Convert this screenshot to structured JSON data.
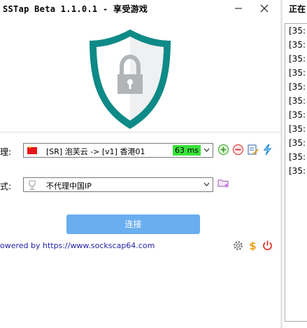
{
  "window": {
    "title": "SSTap Beta 1.1.0.1 - 享受游戏"
  },
  "proxy": {
    "label": "理:",
    "server": "[SR] 泡芙云 -> [v1] 香港01",
    "latency": "63 ms",
    "flag_icon": "china-flag-icon"
  },
  "mode": {
    "label": "式:",
    "value": "不代理中国IP"
  },
  "connect_label": "连接",
  "powered_text": "owered by https://www.sockscap64.com",
  "log": {
    "title": "正在",
    "lines": [
      "[35:",
      "[35:",
      "[35:",
      "[35:",
      "[35:",
      "[35:",
      "[35:",
      "[35:",
      "[35:",
      "[35:",
      "[35:"
    ]
  },
  "colors": {
    "shield_teal": "#0e8a87",
    "lock_gray": "#b2b5b7",
    "connect_button": "#6aaef0",
    "latency_bg": "#3ae23a",
    "link_text": "#2222a8"
  }
}
